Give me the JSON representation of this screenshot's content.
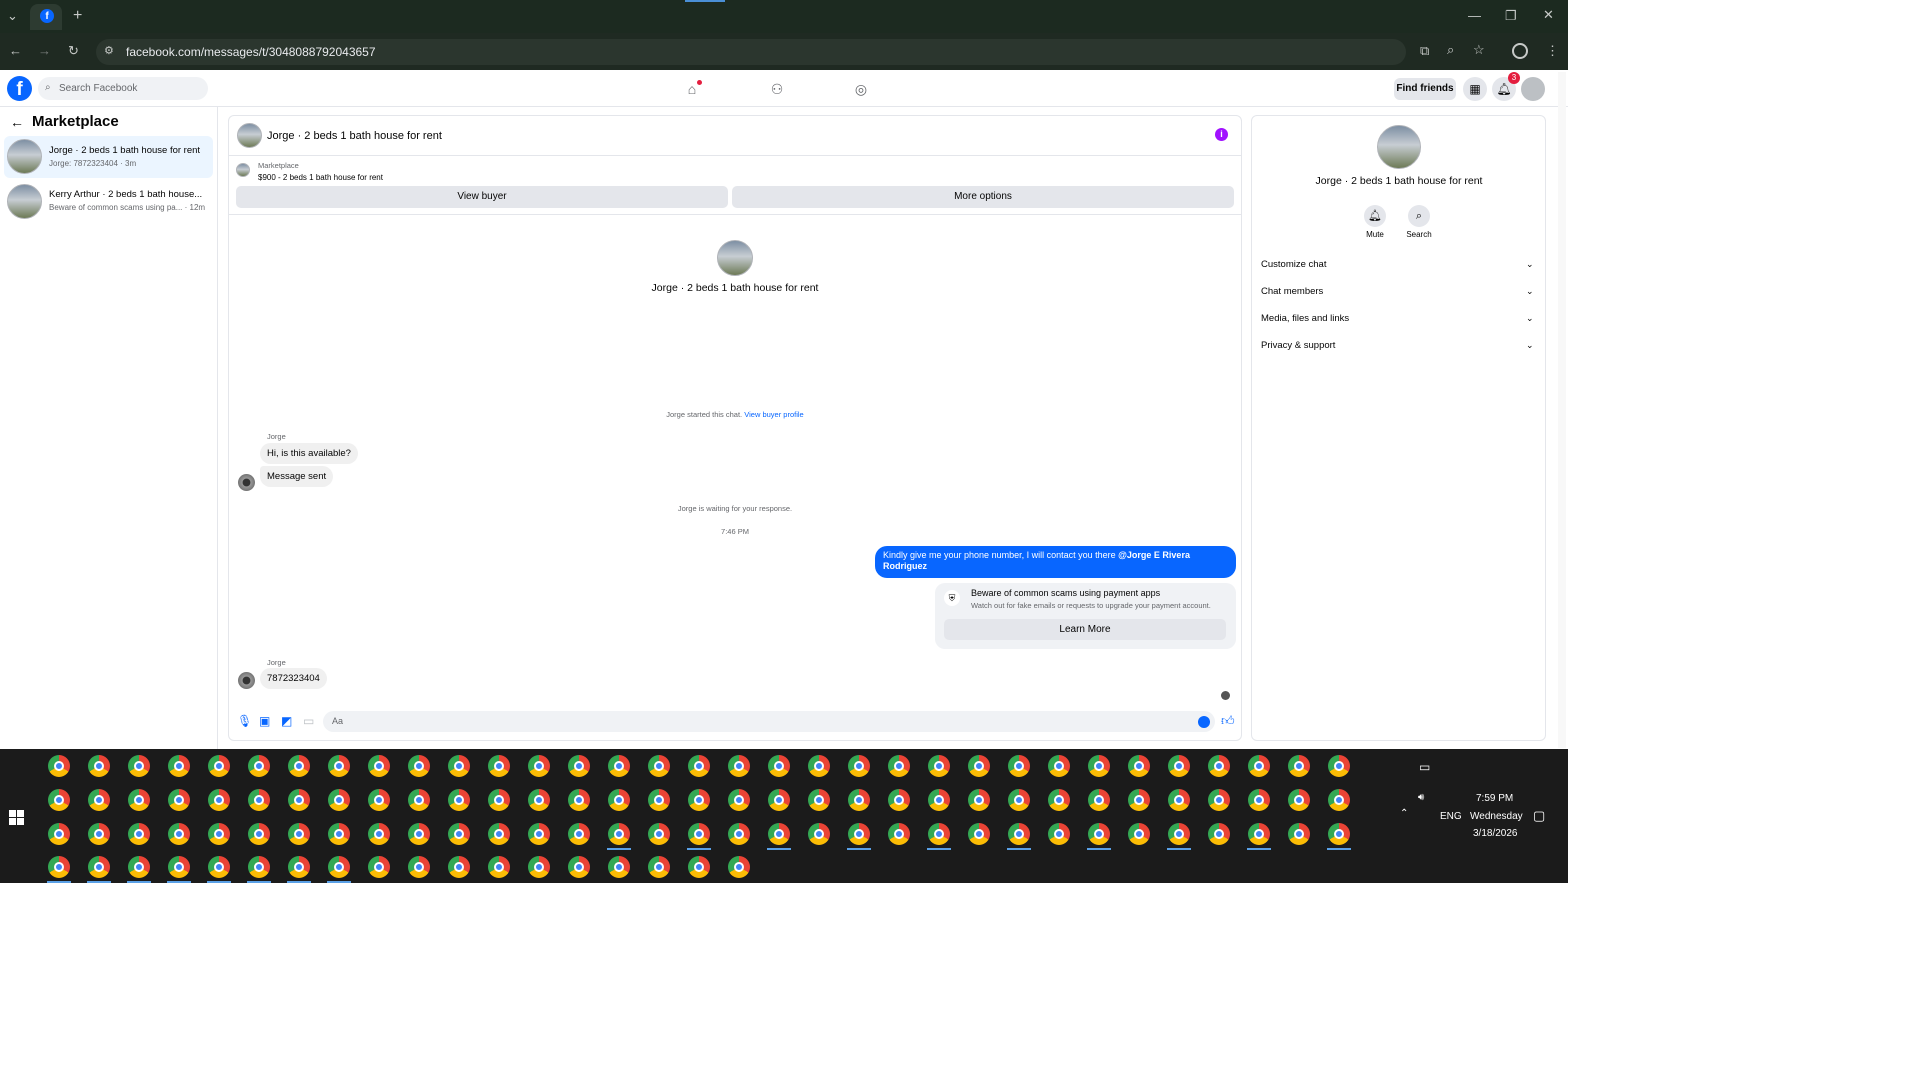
{
  "browser": {
    "url": "facebook.com/messages/t/3048088792043657"
  },
  "header": {
    "search_placeholder": "Search Facebook",
    "find_friends": "Find friends",
    "notif_count": "3"
  },
  "left": {
    "title": "Marketplace",
    "conversations": [
      {
        "name": "Jorge · 2 beds 1 bath house for rent",
        "sub": "Jorge: 7872323404 · 3m"
      },
      {
        "name": "Kerry Arthur · 2 beds 1 bath house...",
        "sub": "Beware of common scams using pa... · 12m"
      }
    ]
  },
  "chat": {
    "title": "Jorge · 2 beds 1 bath house for rent",
    "listing_source": "Marketplace",
    "listing_desc": "$900 - 2 beds 1 bath house for rent",
    "view_buyer": "View buyer",
    "more_options": "More options",
    "profile_name": "Jorge · 2 beds 1 bath house for rent",
    "started_text": "Jorge started this chat.",
    "view_buyer_profile": "View buyer profile",
    "sender1": "Jorge",
    "msg1": "Hi, is this available?",
    "msg2": "Message sent",
    "waiting": "Jorge is waiting for your response.",
    "time": "7:46 PM",
    "my_msg": "Kindly give me your phone number, I will contact you there",
    "my_mention": "@Jorge E Rivera Rodriguez",
    "scam_title": "Beware of common scams using payment apps",
    "scam_body": "Watch out for fake emails or requests to upgrade your payment account.",
    "learn_more": "Learn More",
    "sender2": "Jorge",
    "msg3": "7872323404",
    "composer_placeholder": "Aa"
  },
  "right": {
    "name": "Jorge · 2 beds 1 bath house for rent",
    "mute": "Mute",
    "search": "Search",
    "items": [
      "Customize chat",
      "Chat members",
      "Media, files and links",
      "Privacy & support"
    ]
  },
  "taskbar": {
    "lang": "ENG",
    "time": "7:59 PM",
    "day": "Wednesday",
    "date": "3/18/2026"
  },
  "colors": {
    "accent": "#0866ff",
    "info": "#a112ff"
  }
}
